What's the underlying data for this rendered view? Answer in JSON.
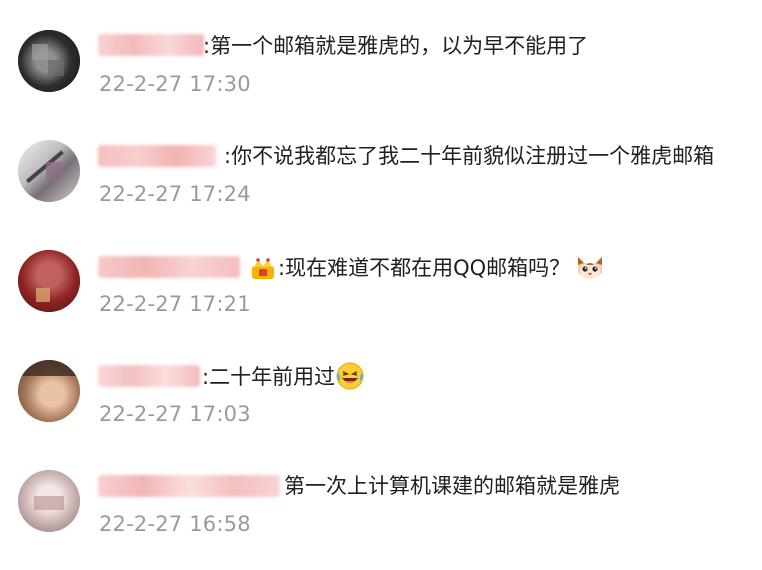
{
  "comments": [
    {
      "text": ":第一个邮箱就是雅虎的，以为早不能用了",
      "time": "22-2-27 17:30"
    },
    {
      "text": ":你不说我都忘了我二十年前貌似注册过一个雅虎邮箱",
      "time": "22-2-27 17:24"
    },
    {
      "text": ":现在难道不都在用QQ邮箱吗？",
      "time": "22-2-27 17:21",
      "icons": [
        "vip-badge-icon",
        "cat-face-icon"
      ]
    },
    {
      "text": ":二十年前用过",
      "time": "22-2-27 17:03",
      "icons": [
        "laughing-tears-icon"
      ]
    },
    {
      "text": "第一次上计算机课建的邮箱就是雅虎",
      "time": "22-2-27 16:58"
    }
  ],
  "colors": {
    "text": "#1f1f1f",
    "time": "#9a9a9a",
    "name_blur": "#f3b8b8"
  }
}
